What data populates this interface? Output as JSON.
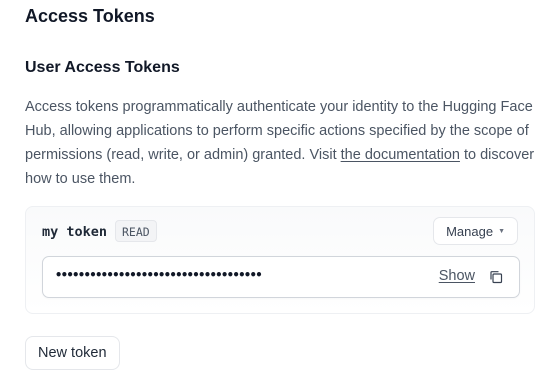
{
  "page": {
    "title": "Access Tokens"
  },
  "user_tokens": {
    "section_title": "User Access Tokens",
    "description_text": "Access tokens programmatically authenticate your identity to the Hugging Face Hub, allowing applications to perform specific actions specified by the scope of permissions (read, write, or admin) granted. Visit ",
    "description_link": "the documentation",
    "description_suffix": " to discover how to use them."
  },
  "token": {
    "name": "my token",
    "role_badge": "READ",
    "manage_label": "Manage",
    "masked_value": "••••••••••••••••••••••••••••••••••••",
    "show_label": "Show",
    "copy_icon": "copy-icon"
  },
  "actions": {
    "new_token_label": "New token"
  },
  "colors": {
    "text_primary": "#111827",
    "text_muted": "#4b5563",
    "border": "#e5e7eb"
  }
}
